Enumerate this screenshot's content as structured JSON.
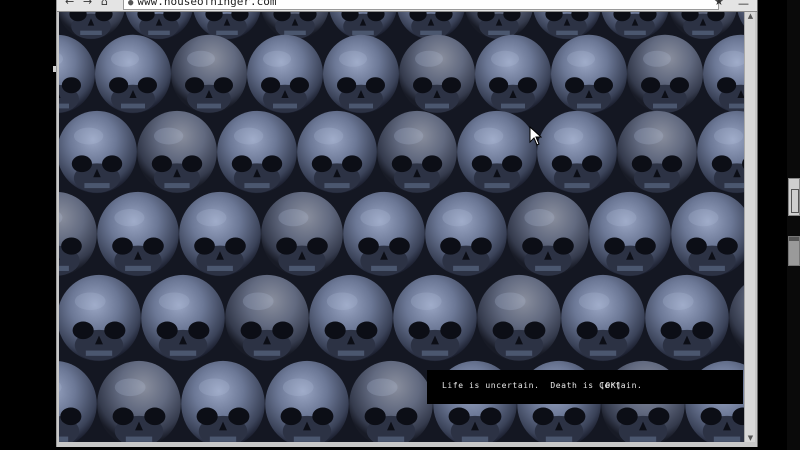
{
  "browser": {
    "nav": {
      "back_icon": "back-arrow-icon",
      "forward_icon": "forward-arrow-icon",
      "home_icon": "home-icon"
    },
    "url": "www.houseofhinger.com",
    "bookmark_icon": "star-icon",
    "minimize_icon": "minimize-icon",
    "content_image": "wall of stacked human skulls (blue-grey tint)"
  },
  "popup": {
    "message": "Life is uncertain.  Death is Certain.",
    "ok_label": "[OK]"
  },
  "colors": {
    "popup_bg": "#000000",
    "popup_text": "#e8e8e8",
    "window_chrome": "#c8c8c8",
    "skull_tint": "#6f7c9c"
  }
}
